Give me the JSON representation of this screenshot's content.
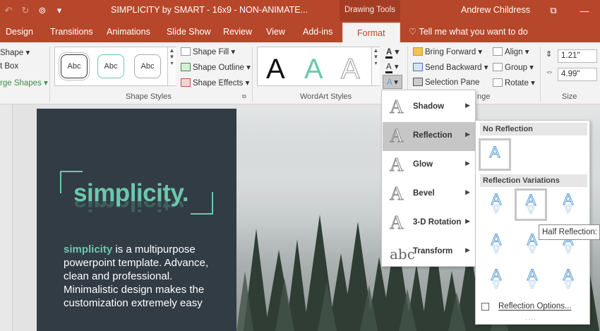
{
  "titlebar": {
    "title": "SIMPLICITY by SMART - 16x9 - NON-ANIMATE...",
    "contextual_tab": "Drawing Tools",
    "user": "Andrew Childress"
  },
  "tabs": [
    "Design",
    "Transitions",
    "Animations",
    "Slide Show",
    "Review",
    "View",
    "Add-ins",
    "Format"
  ],
  "tell_me": "Tell me what you want to do",
  "ribbon": {
    "insert_shapes": {
      "edit_shape": "Shape",
      "text_box": "t Box",
      "merge_shapes": "rge Shapes"
    },
    "shape_styles": {
      "label": "Shape Styles",
      "swatch_label": "Abc",
      "shape_fill": "Shape Fill",
      "shape_outline": "Shape Outline",
      "shape_effects": "Shape Effects"
    },
    "wordart_styles": {
      "label": "WordArt Styles",
      "letter": "A"
    },
    "arrange": {
      "label": "nge",
      "bring_forward": "Bring Forward",
      "send_backward": "Send Backward",
      "selection_pane": "Selection Pane",
      "align": "Align",
      "group": "Group",
      "rotate": "Rotate"
    },
    "size": {
      "label": "Size",
      "height": "1.21\"",
      "width": "4.99\""
    }
  },
  "slide": {
    "title": "simplicity.",
    "body_highlight": "simplicity",
    "body_text": " is a multipurpose powerpoint template. Advance, clean and professional. Minimalistic design makes the customization extremely easy"
  },
  "text_effects_menu": {
    "items": [
      {
        "label": "Shadow",
        "glyph": "A"
      },
      {
        "label": "Reflection",
        "glyph": "A"
      },
      {
        "label": "Glow",
        "glyph": "A"
      },
      {
        "label": "Bevel",
        "glyph": "A"
      },
      {
        "label": "3-D Rotation",
        "glyph": "A"
      },
      {
        "label": "Transform",
        "glyph": "abc"
      }
    ]
  },
  "reflection_submenu": {
    "no_reflection": "No Reflection",
    "variations": "Reflection Variations",
    "tooltip": "Half Reflection: T",
    "options": "Reflection Options..."
  },
  "colors": {
    "accent_red": "#b7472a",
    "slide_dark": "#323c45",
    "teal": "#6cc8ad"
  }
}
